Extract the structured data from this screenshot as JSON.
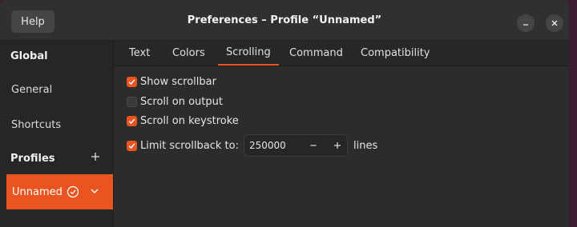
{
  "titlebar": {
    "help_label": "Help",
    "title": "Preferences – Profile “Unnamed”",
    "minimize_icon": "minimize-icon",
    "close_icon": "close-icon"
  },
  "sidebar": {
    "global_heading": "Global",
    "items": [
      {
        "label": "General"
      },
      {
        "label": "Shortcuts"
      }
    ],
    "profiles_heading": "Profiles",
    "add_icon": "plus-icon",
    "profile": {
      "name": "Unnamed",
      "default_icon": "check-circle-icon",
      "menu_icon": "chevron-down-icon"
    }
  },
  "tabs": [
    {
      "label": "Text",
      "active": false
    },
    {
      "label": "Colors",
      "active": false
    },
    {
      "label": "Scrolling",
      "active": true
    },
    {
      "label": "Command",
      "active": false
    },
    {
      "label": "Compatibility",
      "active": false
    }
  ],
  "scrolling": {
    "options": [
      {
        "label": "Show scrollbar",
        "checked": true
      },
      {
        "label": "Scroll on output",
        "checked": false
      },
      {
        "label": "Scroll on keystroke",
        "checked": true
      },
      {
        "label": "Limit scrollback to:",
        "checked": true
      }
    ],
    "scrollback_value": "250000",
    "scrollback_unit": "lines",
    "decrement_icon": "minus-icon",
    "increment_icon": "plus-icon"
  },
  "colors": {
    "accent": "#e95420",
    "window_bg": "#2b2b2b",
    "sidebar_bg": "#262626"
  }
}
